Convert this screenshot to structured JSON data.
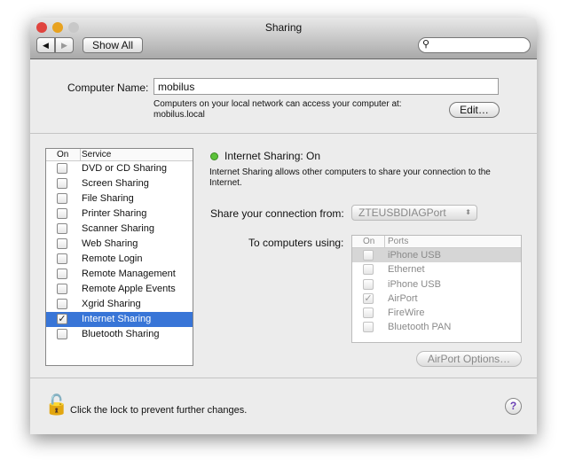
{
  "window": {
    "title": "Sharing"
  },
  "toolbar": {
    "show_all": "Show All",
    "search_placeholder": ""
  },
  "computer_name": {
    "label": "Computer Name:",
    "value": "mobilus",
    "info": "Computers on your local network can access your computer at:",
    "address": "mobilus.local",
    "edit": "Edit…"
  },
  "services": {
    "col_on": "On",
    "col_service": "Service",
    "items": [
      {
        "label": "DVD or CD Sharing",
        "on": false
      },
      {
        "label": "Screen Sharing",
        "on": false
      },
      {
        "label": "File Sharing",
        "on": false
      },
      {
        "label": "Printer Sharing",
        "on": false
      },
      {
        "label": "Scanner Sharing",
        "on": false
      },
      {
        "label": "Web Sharing",
        "on": false
      },
      {
        "label": "Remote Login",
        "on": false
      },
      {
        "label": "Remote Management",
        "on": false
      },
      {
        "label": "Remote Apple Events",
        "on": false
      },
      {
        "label": "Xgrid Sharing",
        "on": false
      },
      {
        "label": "Internet Sharing",
        "on": true,
        "selected": true
      },
      {
        "label": "Bluetooth Sharing",
        "on": false
      }
    ]
  },
  "detail": {
    "status": "Internet Sharing: On",
    "status_color": "#5cc23a",
    "description": "Internet Sharing allows other computers to share your connection to the Internet.",
    "share_from_label": "Share your connection from:",
    "share_from_value": "ZTEUSBDIAGPort",
    "to_label": "To computers using:",
    "col_on": "On",
    "col_ports": "Ports",
    "ports": [
      {
        "label": "iPhone USB",
        "on": false
      },
      {
        "label": "Ethernet",
        "on": false
      },
      {
        "label": "iPhone USB",
        "on": false
      },
      {
        "label": "AirPort",
        "on": true
      },
      {
        "label": "FireWire",
        "on": false
      },
      {
        "label": "Bluetooth PAN",
        "on": false
      }
    ],
    "airport_options": "AirPort Options…"
  },
  "footer": {
    "lock_text": "Click the lock to prevent further changes.",
    "help": "?"
  }
}
